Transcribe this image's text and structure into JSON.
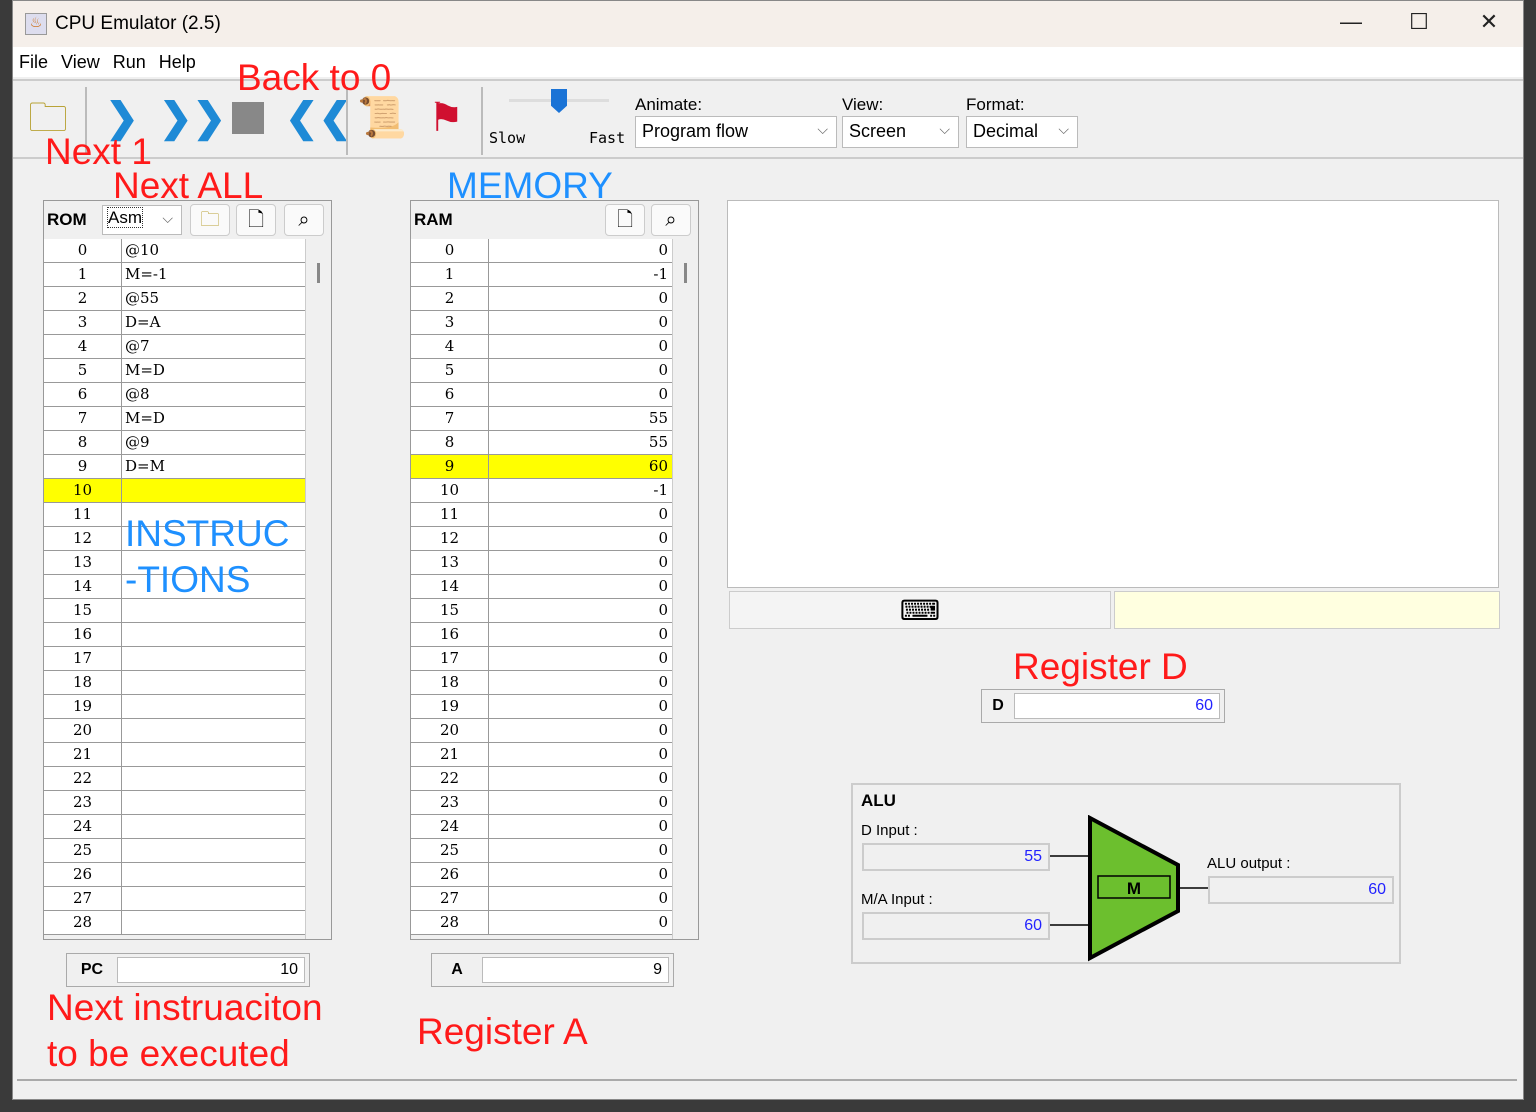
{
  "window": {
    "title": "CPU Emulator (2.5)",
    "minimize": "—",
    "maximize": "☐",
    "close": "✕"
  },
  "menu": [
    "File",
    "View",
    "Run",
    "Help"
  ],
  "toolbar": {
    "slider": {
      "min_label": "Slow",
      "max_label": "Fast",
      "value_fraction": 0.5
    },
    "animate": {
      "label": "Animate:",
      "value": "Program flow"
    },
    "view": {
      "label": "View:",
      "value": "Screen"
    },
    "format": {
      "label": "Format:",
      "value": "Decimal"
    }
  },
  "annotations": {
    "back_to_0": "Back to 0",
    "next_1": "Next 1",
    "next_all": "Next ALL",
    "memory": "MEMORY",
    "instructions_1": "INSTRUC",
    "instructions_2": "-TIONS",
    "register_d": "Register D",
    "next_instr_1": "Next instruaciton",
    "next_instr_2": "to be executed",
    "register_a": "Register A"
  },
  "rom": {
    "title": "ROM",
    "format": "Asm",
    "highlight": 10,
    "rows": [
      "@10",
      "M=-1",
      "@55",
      "D=A",
      "@7",
      "M=D",
      "@8",
      "M=D",
      "@9",
      "D=M",
      "",
      "",
      "",
      "",
      "",
      "",
      "",
      "",
      "",
      "",
      "",
      "",
      "",
      "",
      "",
      "",
      "",
      "",
      ""
    ]
  },
  "ram": {
    "title": "RAM",
    "highlight": 9,
    "rows": [
      "0",
      "-1",
      "0",
      "0",
      "0",
      "0",
      "0",
      "55",
      "55",
      "60",
      "-1",
      "0",
      "0",
      "0",
      "0",
      "0",
      "0",
      "0",
      "0",
      "0",
      "0",
      "0",
      "0",
      "0",
      "0",
      "0",
      "0",
      "0",
      "0"
    ]
  },
  "registers": {
    "pc_label": "PC",
    "pc": "10",
    "a_label": "A",
    "a": "9",
    "d_label": "D",
    "d": "60"
  },
  "alu": {
    "title": "ALU",
    "d_input_label": "D Input :",
    "d_input": "55",
    "ma_input_label": "M/A Input :",
    "ma_input": "60",
    "output_label": "ALU output :",
    "output": "60",
    "op": "M"
  }
}
